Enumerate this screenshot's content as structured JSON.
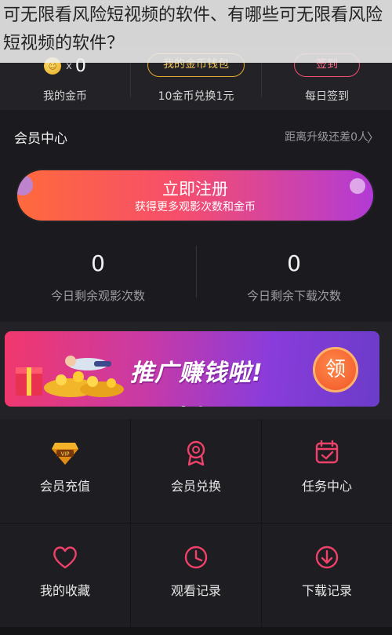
{
  "caption": "可无限看风险短视频的软件、有哪些可无限看风险短视频的软件？",
  "coins": {
    "count_x": "x",
    "count": "0",
    "my_coins_label": "我的金币",
    "wallet_button": "我的金币钱包",
    "exchange_rate": "10金币兑换1元",
    "signin_button": "签到",
    "daily_signin_label": "每日签到"
  },
  "member": {
    "title": "会员中心",
    "upgrade_hint": "距离升级还差0人",
    "register_title": "立即注册",
    "register_subtitle": "获得更多观影次数和金币",
    "watch_count": "0",
    "watch_label": "今日剩余观影次数",
    "download_count": "0",
    "download_label": "今日剩余下载次数"
  },
  "banner": {
    "text": "推广赚钱啦!",
    "claim_button": "领",
    "page_count": 2,
    "active_page": 1
  },
  "grid": [
    {
      "label": "会员充值",
      "icon": "vip-diamond-icon"
    },
    {
      "label": "会员兑换",
      "icon": "medal-icon"
    },
    {
      "label": "任务中心",
      "icon": "calendar-check-icon"
    },
    {
      "label": "我的收藏",
      "icon": "heart-icon"
    },
    {
      "label": "观看记录",
      "icon": "clock-icon"
    },
    {
      "label": "下载记录",
      "icon": "download-icon"
    }
  ],
  "colors": {
    "background": "#1b1b1f",
    "accent_pink": "#f0416a",
    "accent_gold": "#e3a72f"
  }
}
